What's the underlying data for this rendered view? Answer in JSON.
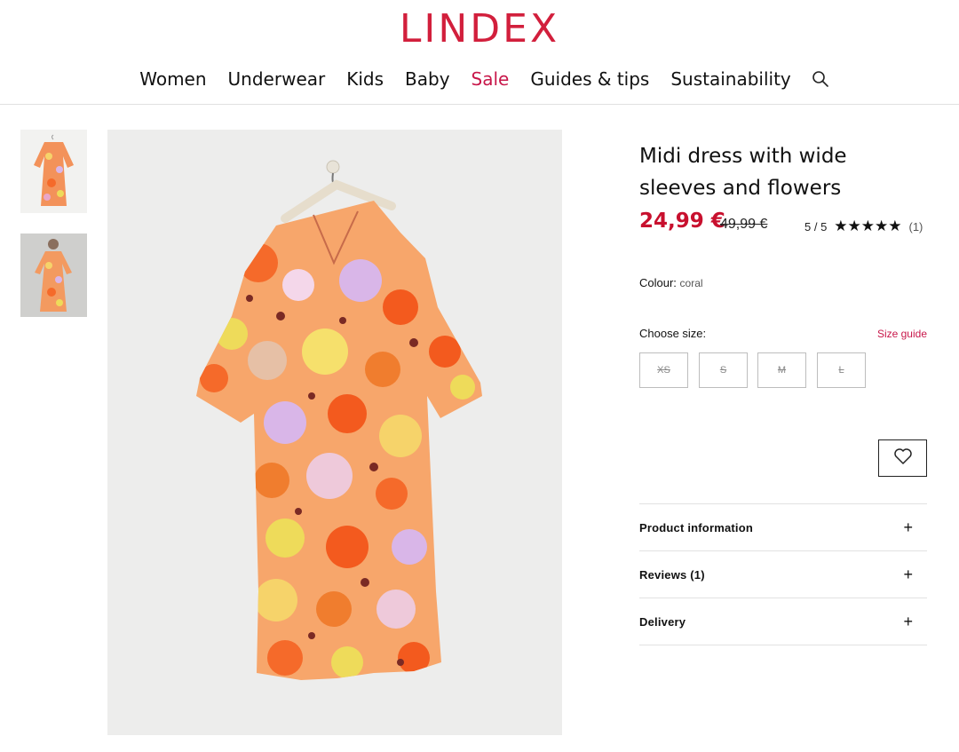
{
  "brand": {
    "logo": "LINDEX",
    "accent": "#d21f3c",
    "sale_color": "#c8174a"
  },
  "nav": {
    "items": [
      "Women",
      "Underwear",
      "Kids",
      "Baby",
      "Sale",
      "Guides & tips",
      "Sustainability"
    ],
    "search_icon": "search-icon"
  },
  "gallery": {
    "thumbnails": [
      "dress-front-thumbnail",
      "dress-model-thumbnail"
    ],
    "main_image": "floral-midi-dress-on-hanger"
  },
  "product": {
    "title": "Midi dress with wide sleeves and flowers",
    "price": "24,99 €",
    "old_price": "49,99 €",
    "rating_text": "5 / 5",
    "rating_stars": "★★★★★",
    "rating_value": 5,
    "review_count": "(1)",
    "colour_label": "Colour:",
    "colour_value": "coral",
    "choose_size_label": "Choose size:",
    "size_guide": "Size guide",
    "sizes": [
      "XS",
      "S",
      "M",
      "L"
    ],
    "sizes_available": false,
    "wishlist_icon": "heart-icon"
  },
  "accordion": [
    {
      "label": "Product information",
      "icon": "+"
    },
    {
      "label": "Reviews (1)",
      "icon": "+"
    },
    {
      "label": "Delivery",
      "icon": "+"
    }
  ]
}
